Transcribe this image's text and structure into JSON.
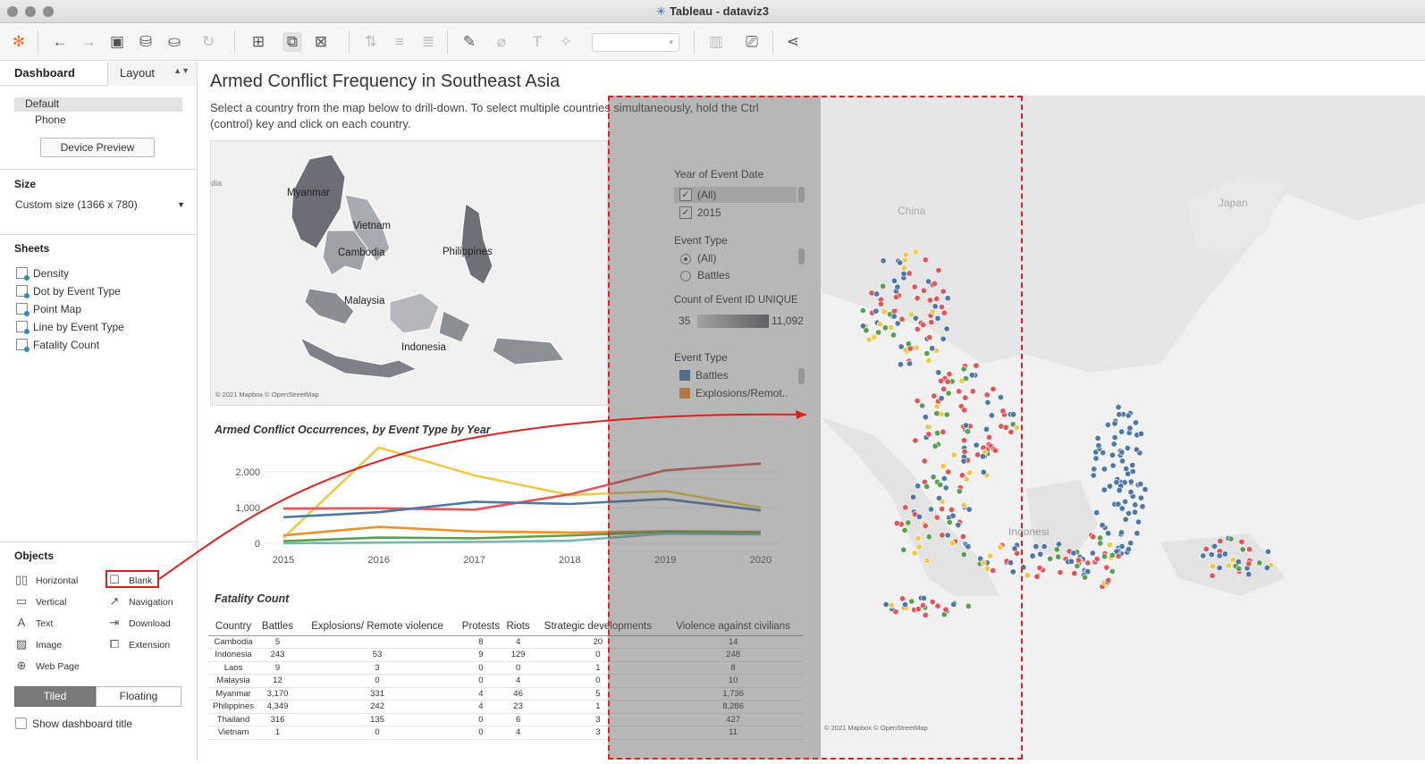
{
  "window": {
    "title": "Tableau - dataviz3",
    "title_icon": "tableau-icon"
  },
  "toolbar": {
    "icons": [
      "tableau-logo-icon",
      "undo-icon",
      "redo-icon",
      "save-icon",
      "new-datasource-icon",
      "pause-update-icon",
      "refresh-icon",
      "new-worksheet-icon",
      "duplicate-icon",
      "clear-icon",
      "swap-icon",
      "sort-asc-icon",
      "sort-desc-icon",
      "highlight-icon",
      "group-icon",
      "label-icon",
      "pin-icon",
      "show-me-icon",
      "presentation-icon",
      "share-icon"
    ]
  },
  "left_panel": {
    "tab_dashboard": "Dashboard",
    "tab_layout": "Layout",
    "devices": [
      "Default",
      "Phone"
    ],
    "device_preview_label": "Device Preview",
    "size_header": "Size",
    "size_value": "Custom size (1366 x 780)",
    "sheets_header": "Sheets",
    "sheets": [
      "Density",
      "Dot by Event Type",
      "Point Map",
      "Line by Event Type",
      "Fatality Count"
    ],
    "objects_header": "Objects",
    "objects": [
      {
        "label": "Horizontal",
        "icon": "horizontal-icon"
      },
      {
        "label": "Blank",
        "icon": "blank-icon"
      },
      {
        "label": "Vertical",
        "icon": "vertical-icon"
      },
      {
        "label": "Navigation",
        "icon": "navigation-icon"
      },
      {
        "label": "Text",
        "icon": "text-icon"
      },
      {
        "label": "Download",
        "icon": "download-icon"
      },
      {
        "label": "Image",
        "icon": "image-icon"
      },
      {
        "label": "Extension",
        "icon": "extension-icon"
      },
      {
        "label": "Web Page",
        "icon": "web-page-icon"
      }
    ],
    "tiled_label": "Tiled",
    "floating_label": "Floating",
    "show_title_label": "Show dashboard title"
  },
  "dashboard": {
    "title": "Armed Conflict Frequency in Southeast Asia",
    "subtitle": "Select a country from the map below to drill-down. To select multiple countries simultaneously, hold the Ctrl (control) key and click on each country.",
    "map_labels": [
      "Myanmar",
      "Vietnam",
      "Cambodia",
      "Philippines",
      "Malaysia",
      "Indonesia"
    ],
    "map_edge_label": "dia",
    "copyright": "© 2021 Mapbox © OpenStreetMap",
    "filters": {
      "year_title": "Year of Event Date",
      "year_items": [
        "(All)",
        "2015"
      ],
      "event_title": "Event Type",
      "event_items": [
        "(All)",
        "Battles"
      ],
      "count_title": "Count of Event ID UNIQUE",
      "count_min": "35",
      "count_max": "11,092",
      "legend_title": "Event Type",
      "legend_items": [
        "Battles",
        "Explosions/Remot.."
      ]
    },
    "big_map_labels": [
      "China",
      "Japan",
      "Indonesi"
    ],
    "big_map_copyright": "© 2021 Mapbox © OpenStreetMap"
  },
  "colors": {
    "battles": "#4e79a7",
    "explosions": "#f28e2b",
    "protests": "#edc948",
    "riots": "#59a14f",
    "strategic": "#76b7b2",
    "violence": "#e15759",
    "red_annotation": "#e02020"
  },
  "chart_data": {
    "type": "line",
    "title": "Armed Conflict Occurrences, by Event Type by Year",
    "x": [
      "2015",
      "2016",
      "2017",
      "2018",
      "2019",
      "2020"
    ],
    "yticks": [
      "0",
      "1,000",
      "2,000"
    ],
    "ylim": [
      0,
      2700
    ],
    "series": [
      {
        "color": "#edc948",
        "values": [
          150,
          2680,
          1900,
          1350,
          1460,
          1000
        ]
      },
      {
        "color": "#e15759",
        "values": [
          970,
          980,
          940,
          1370,
          2040,
          2230
        ]
      },
      {
        "color": "#4e79a7",
        "values": [
          730,
          870,
          1160,
          1100,
          1240,
          920
        ]
      },
      {
        "color": "#f28e2b",
        "values": [
          220,
          460,
          330,
          300,
          340,
          320
        ]
      },
      {
        "color": "#59a14f",
        "values": [
          60,
          160,
          140,
          220,
          320,
          290
        ]
      },
      {
        "color": "#76b7b2",
        "values": [
          0,
          20,
          40,
          70,
          270,
          250
        ]
      }
    ]
  },
  "fatality": {
    "title": "Fatality Count",
    "headers": [
      "Country",
      "Battles",
      "Explosions/ Remote violence",
      "Protests",
      "Riots",
      "Strategic developments",
      "Violence against civilians"
    ],
    "rows": [
      [
        "Cambodia",
        "5",
        "",
        "8",
        "4",
        "20",
        "14"
      ],
      [
        "Indonesia",
        "243",
        "53",
        "9",
        "129",
        "0",
        "248"
      ],
      [
        "Laos",
        "9",
        "3",
        "0",
        "0",
        "1",
        "8"
      ],
      [
        "Malaysia",
        "12",
        "0",
        "0",
        "4",
        "0",
        "10"
      ],
      [
        "Myanmar",
        "3,170",
        "331",
        "4",
        "46",
        "5",
        "1,736"
      ],
      [
        "Philippines",
        "4,349",
        "242",
        "4",
        "23",
        "1",
        "8,286"
      ],
      [
        "Thailand",
        "316",
        "135",
        "0",
        "6",
        "3",
        "427"
      ],
      [
        "Vietnam",
        "1",
        "0",
        "0",
        "4",
        "3",
        "11"
      ]
    ]
  }
}
